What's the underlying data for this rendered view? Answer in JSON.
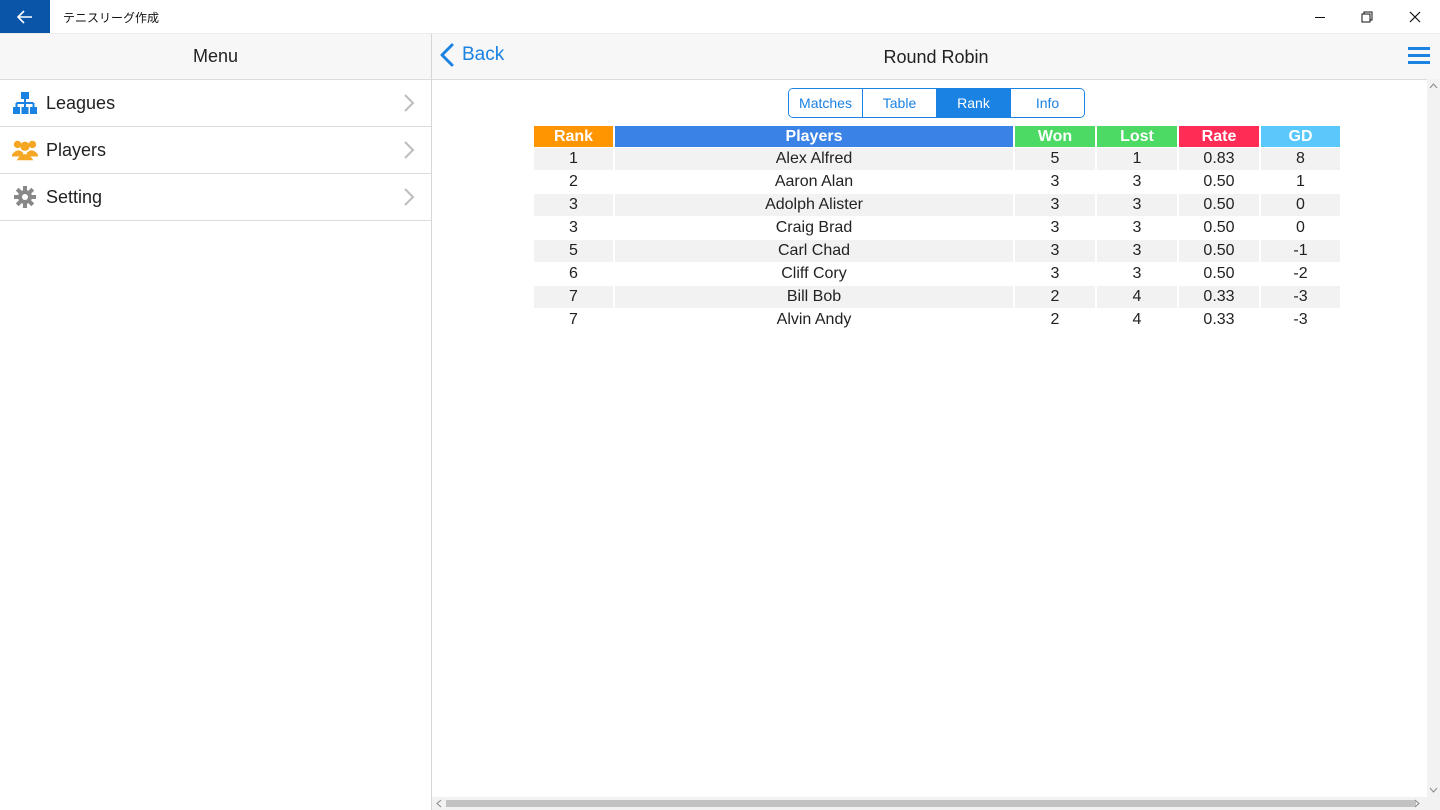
{
  "window": {
    "title": "テニスリーグ作成",
    "back_icon": "arrow-left-icon",
    "controls": [
      "minimize-icon",
      "restore-icon",
      "close-icon"
    ]
  },
  "sidebar": {
    "header": "Menu",
    "items": [
      {
        "label": "Leagues",
        "icon": "sitemap-icon",
        "color": "#1a82e2"
      },
      {
        "label": "Players",
        "icon": "users-icon",
        "color": "#f5a623"
      },
      {
        "label": "Setting",
        "icon": "gear-icon",
        "color": "#888888"
      }
    ]
  },
  "main": {
    "back_label": "Back",
    "title": "Round Robin",
    "tabs": [
      {
        "label": "Matches",
        "active": false
      },
      {
        "label": "Table",
        "active": false
      },
      {
        "label": "Rank",
        "active": true
      },
      {
        "label": "Info",
        "active": false
      }
    ],
    "table": {
      "columns": [
        {
          "label": "Rank",
          "color": "#ff9500"
        },
        {
          "label": "Players",
          "color": "#3b82e6"
        },
        {
          "label": "Won",
          "color": "#4cd964"
        },
        {
          "label": "Lost",
          "color": "#4cd964"
        },
        {
          "label": "Rate",
          "color": "#ff2d55"
        },
        {
          "label": "GD",
          "color": "#5ac8fa"
        }
      ],
      "rows": [
        [
          "1",
          "Alex Alfred",
          "5",
          "1",
          "0.83",
          "8"
        ],
        [
          "2",
          "Aaron Alan",
          "3",
          "3",
          "0.50",
          "1"
        ],
        [
          "3",
          "Adolph Alister",
          "3",
          "3",
          "0.50",
          "0"
        ],
        [
          "3",
          "Craig Brad",
          "3",
          "3",
          "0.50",
          "0"
        ],
        [
          "5",
          "Carl Chad",
          "3",
          "3",
          "0.50",
          "-1"
        ],
        [
          "6",
          "Cliff Cory",
          "3",
          "3",
          "0.50",
          "-2"
        ],
        [
          "7",
          "Bill Bob",
          "2",
          "4",
          "0.33",
          "-3"
        ],
        [
          "7",
          "Alvin Andy",
          "2",
          "4",
          "0.33",
          "-3"
        ]
      ]
    }
  },
  "colors": {
    "accent": "#1a82e2",
    "titlebar_back": "#0a55a8"
  }
}
